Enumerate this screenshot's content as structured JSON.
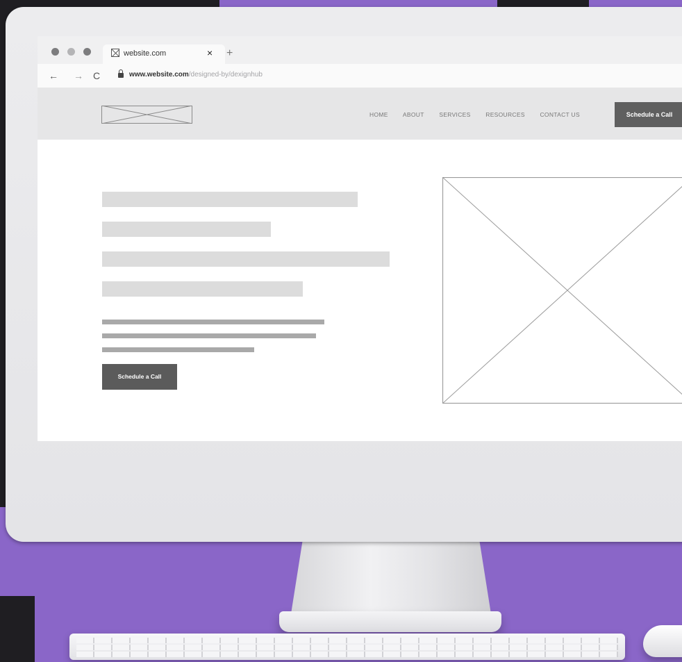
{
  "browser": {
    "tab_title": "website.com",
    "tab_close": "×",
    "new_tab": "+",
    "nav_back": "←",
    "nav_forward": "→",
    "nav_reload": "C",
    "url_host": "www.website.com",
    "url_path": "/designed-by/dexignhub"
  },
  "site": {
    "nav": [
      "HOME",
      "ABOUT",
      "SERVICES",
      "RESOURCES",
      "CONTACT US"
    ],
    "header_cta": "Schedule a Call",
    "hero_cta": "Schedule a Call"
  },
  "colors": {
    "background_purple": "#8a66c8",
    "background_dark": "#1f1e22",
    "button_gray": "#5f5f5f",
    "placeholder_gray": "#dcdcdc"
  },
  "icons": {
    "traffic_lights": "three-dot-icons",
    "tab_favicon": "image-placeholder-icon",
    "lock": "lock-icon"
  }
}
